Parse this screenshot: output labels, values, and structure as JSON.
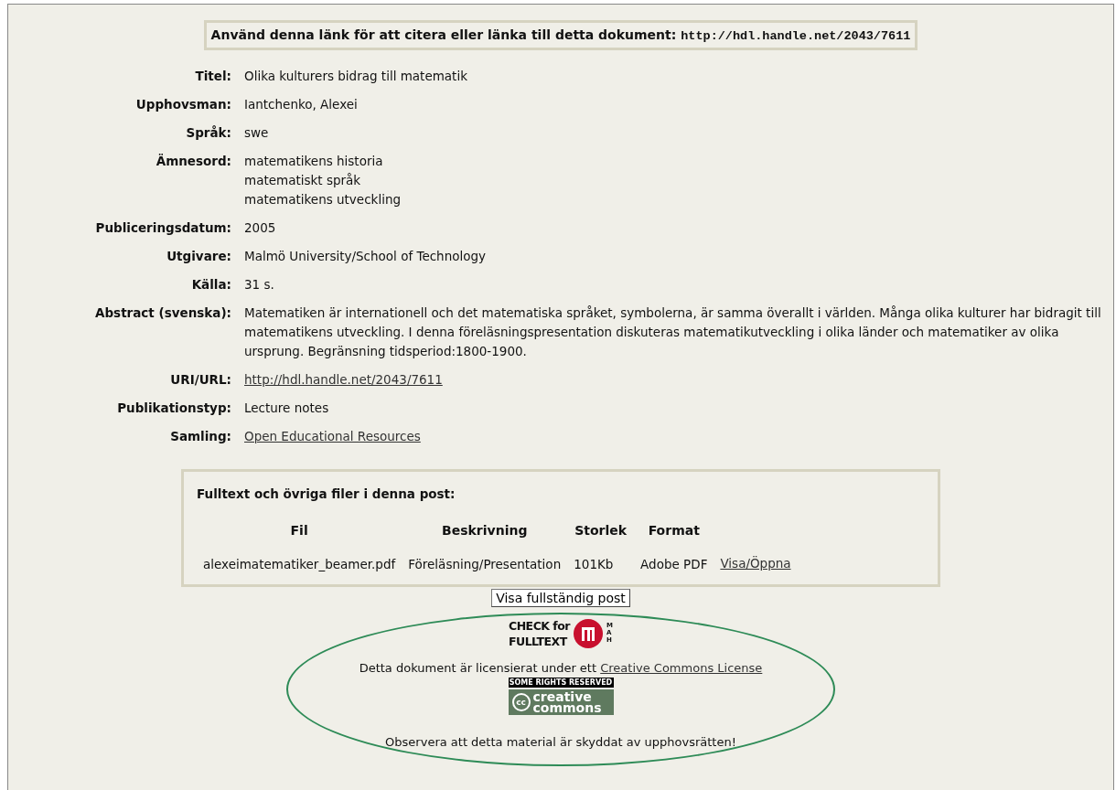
{
  "citation": {
    "label": "Använd denna länk för att citera eller länka till detta dokument:",
    "url": "http://hdl.handle.net/2043/7611"
  },
  "fields": [
    {
      "label": "Titel:",
      "kind": "text",
      "values": [
        "Olika kulturers bidrag till matematik"
      ]
    },
    {
      "label": "Upphovsman:",
      "kind": "text",
      "values": [
        "Iantchenko, Alexei"
      ]
    },
    {
      "label": "Språk:",
      "kind": "text",
      "values": [
        "swe"
      ]
    },
    {
      "label": "Ämnesord:",
      "kind": "text",
      "values": [
        "matematikens historia",
        "matematiskt språk",
        "matematikens utveckling"
      ]
    },
    {
      "label": "Publiceringsdatum:",
      "kind": "text",
      "values": [
        "2005"
      ]
    },
    {
      "label": "Utgivare:",
      "kind": "text",
      "values": [
        "Malmö University/School of Technology"
      ]
    },
    {
      "label": "Källa:",
      "kind": "text",
      "values": [
        "31 s."
      ]
    },
    {
      "label": "Abstract (svenska):",
      "kind": "text",
      "values": [
        "Matematiken är internationell och det matematiska språket, symbolerna, är samma överallt i världen. Många olika kulturer har bidragit till matematikens utveckling. I denna föreläsningspresentation diskuteras matematikutveckling i olika länder och matematiker av olika ursprung. Begränsning tidsperiod:1800-1900."
      ]
    },
    {
      "label": "URI/URL:",
      "kind": "link",
      "values": [
        "http://hdl.handle.net/2043/7611"
      ]
    },
    {
      "label": "Publikationstyp:",
      "kind": "text",
      "values": [
        "Lecture notes"
      ]
    },
    {
      "label": "Samling:",
      "kind": "link",
      "values": [
        "Open Educational Resources"
      ]
    }
  ],
  "files": {
    "heading": "Fulltext och övriga filer i denna post:",
    "columns": [
      "Fil",
      "Beskrivning",
      "Storlek",
      "Format"
    ],
    "rows": [
      {
        "cells": [
          "alexeimatematiker_beamer.pdf",
          "Föreläsning/Presentation",
          "101Kb",
          "Adobe PDF"
        ],
        "action": "Visa/Öppna"
      }
    ]
  },
  "full_record_button": "Visa fullständig post",
  "footer": {
    "check_badge": [
      "CHECK for",
      "FULLTEXT"
    ],
    "badge_letters": "MAH",
    "license_text": "Detta dokument är licensierat under ett",
    "license_link": "Creative Commons License",
    "cc_badge": {
      "top": "SOME RIGHTS RESERVED",
      "line_1": "creative",
      "line_2": "commons",
      "symbol": "cc"
    },
    "notice": "Observera att detta material är skyddat av upphovsrätten!"
  }
}
